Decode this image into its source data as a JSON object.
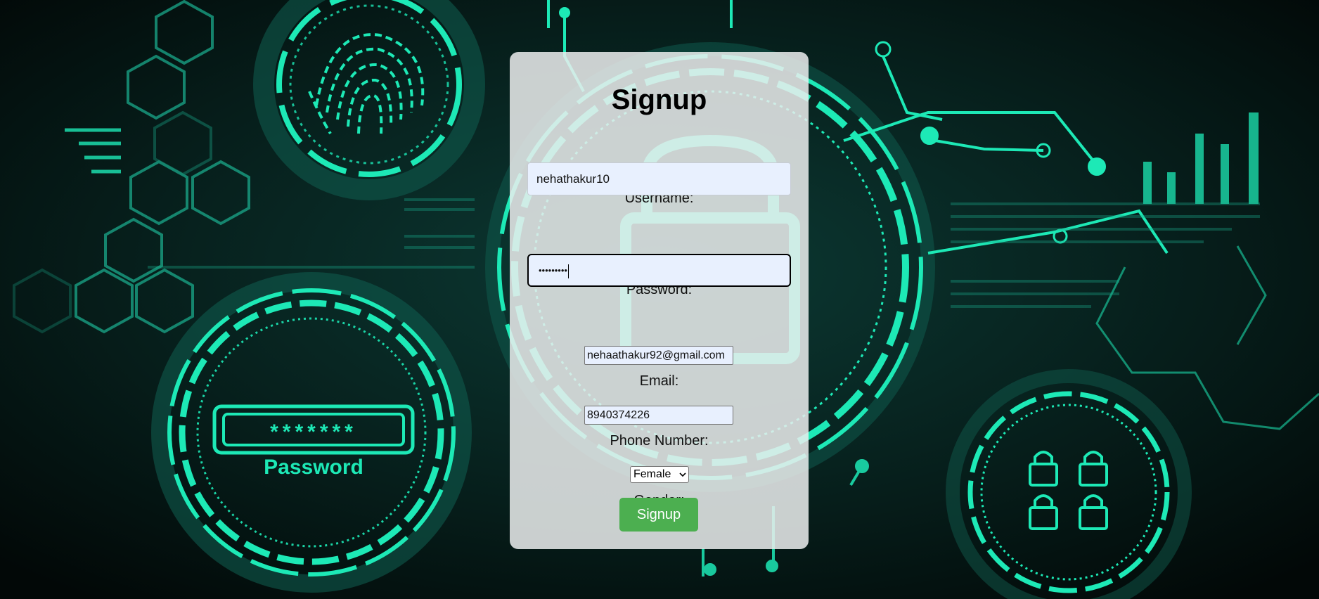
{
  "background": {
    "description_icon_names": [
      "fingerprint-icon",
      "padlock-icon",
      "password-field-icon",
      "circuit-lines",
      "hexagon-pattern"
    ],
    "badge_password_mask": "*******",
    "badge_password_label": "Password",
    "accent_color": "#1de9b6"
  },
  "form": {
    "title": "Signup",
    "username_label": "Username:",
    "username_value": "nehathakur10",
    "password_label": "Password:",
    "password_mask": "•••••••••",
    "email_label": "Email:",
    "email_value": "nehaathakur92@gmail.com",
    "phone_label": "Phone Number:",
    "phone_value": "8940374226",
    "gender_label": "Gender:",
    "gender_value": "Female",
    "submit_label": "Signup",
    "submit_color": "#4caf50"
  }
}
